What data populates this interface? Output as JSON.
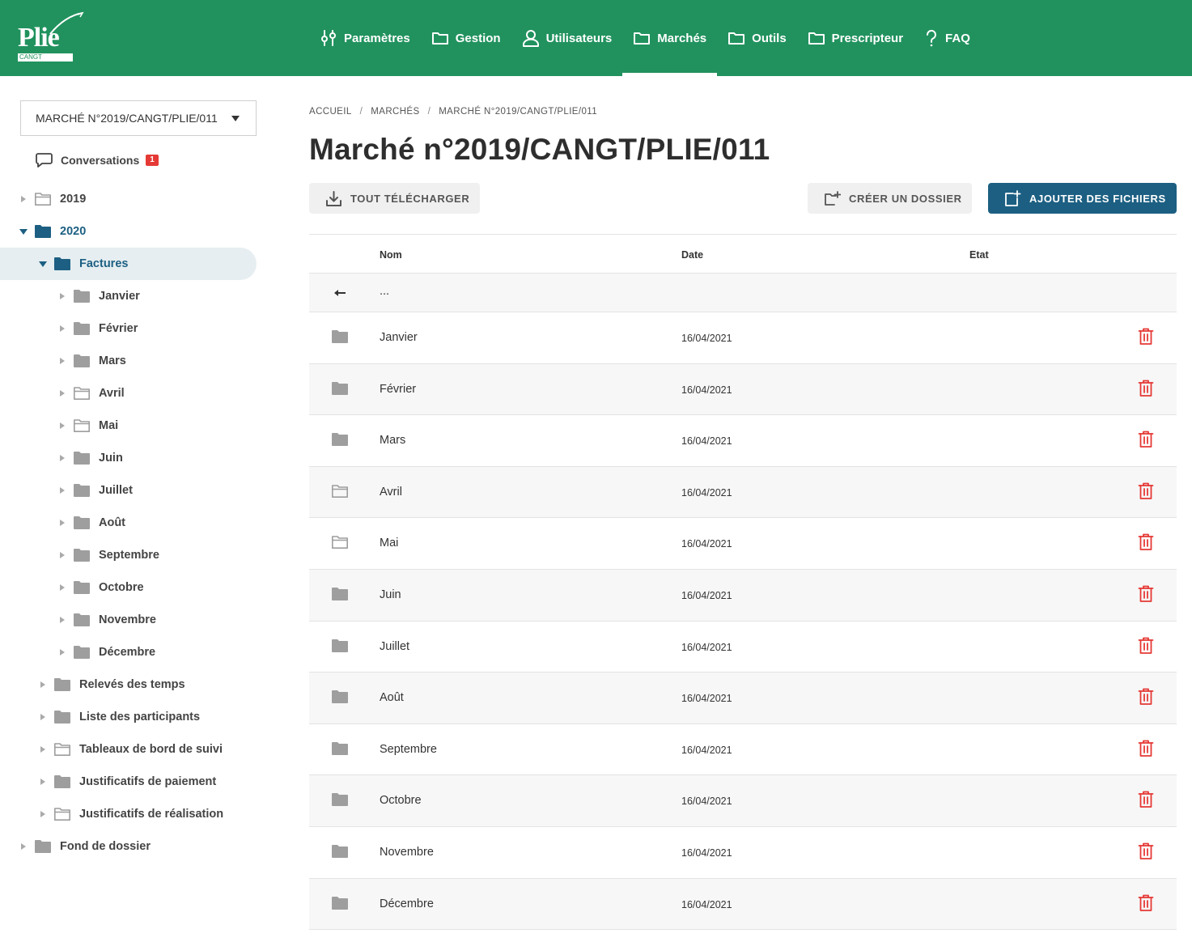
{
  "header": {
    "logo_text": "Plie",
    "logo_tag": "CANGT",
    "nav": [
      {
        "label": "Paramètres",
        "icon": "sliders-icon"
      },
      {
        "label": "Gestion",
        "icon": "folder-icon"
      },
      {
        "label": "Utilisateurs",
        "icon": "user-icon"
      },
      {
        "label": "Marchés",
        "icon": "folder-icon",
        "active": true
      },
      {
        "label": "Outils",
        "icon": "folder-icon"
      },
      {
        "label": "Prescripteur",
        "icon": "folder-icon"
      },
      {
        "label": "FAQ",
        "icon": "question-icon"
      }
    ]
  },
  "sidebar": {
    "market_select": "MARCHÉ N°2019/CANGT/PLIE/011",
    "conversations_label": "Conversations",
    "conversations_count": "1",
    "tree": [
      {
        "label": "2019",
        "level": 0,
        "expanded": false,
        "filled": false
      },
      {
        "label": "2020",
        "level": 0,
        "expanded": true,
        "filled": true
      },
      {
        "label": "Factures",
        "level": 1,
        "expanded": true,
        "filled": true,
        "selected": true
      },
      {
        "label": "Janvier",
        "level": 2,
        "filled": true
      },
      {
        "label": "Février",
        "level": 2,
        "filled": true
      },
      {
        "label": "Mars",
        "level": 2,
        "filled": true
      },
      {
        "label": "Avril",
        "level": 2,
        "filled": false
      },
      {
        "label": "Mai",
        "level": 2,
        "filled": false
      },
      {
        "label": "Juin",
        "level": 2,
        "filled": true
      },
      {
        "label": "Juillet",
        "level": 2,
        "filled": true
      },
      {
        "label": "Août",
        "level": 2,
        "filled": true
      },
      {
        "label": "Septembre",
        "level": 2,
        "filled": true
      },
      {
        "label": "Octobre",
        "level": 2,
        "filled": true
      },
      {
        "label": "Novembre",
        "level": 2,
        "filled": true
      },
      {
        "label": "Décembre",
        "level": 2,
        "filled": true
      },
      {
        "label": "Relevés des temps",
        "level": 1,
        "filled": true
      },
      {
        "label": "Liste des participants",
        "level": 1,
        "filled": true
      },
      {
        "label": "Tableaux de bord de suivi",
        "level": 1,
        "filled": false
      },
      {
        "label": "Justificatifs de paiement",
        "level": 1,
        "filled": true
      },
      {
        "label": "Justificatifs de réalisation",
        "level": 1,
        "filled": false
      },
      {
        "label": "Fond de dossier",
        "level": 0,
        "filled": true
      }
    ]
  },
  "main": {
    "breadcrumb": [
      "ACCUEIL",
      "MARCHÉS",
      "MARCHÉ N°2019/CANGT/PLIE/011"
    ],
    "breadcrumb_sep": "/",
    "title": "Marché n°2019/CANGT/PLIE/011",
    "buttons": {
      "download_all": "TOUT TÉLÉCHARGER",
      "create_folder": "CRÉER UN DOSSIER",
      "add_files": "AJOUTER DES FICHIERS"
    },
    "table": {
      "headers": {
        "name": "Nom",
        "date": "Date",
        "state": "Etat"
      },
      "parent_label": "...",
      "rows": [
        {
          "name": "Janvier",
          "date": "16/04/2021",
          "filled": true
        },
        {
          "name": "Février",
          "date": "16/04/2021",
          "filled": true
        },
        {
          "name": "Mars",
          "date": "16/04/2021",
          "filled": true
        },
        {
          "name": "Avril",
          "date": "16/04/2021",
          "filled": false
        },
        {
          "name": "Mai",
          "date": "16/04/2021",
          "filled": false
        },
        {
          "name": "Juin",
          "date": "16/04/2021",
          "filled": true
        },
        {
          "name": "Juillet",
          "date": "16/04/2021",
          "filled": true
        },
        {
          "name": "Août",
          "date": "16/04/2021",
          "filled": true
        },
        {
          "name": "Septembre",
          "date": "16/04/2021",
          "filled": true
        },
        {
          "name": "Octobre",
          "date": "16/04/2021",
          "filled": true
        },
        {
          "name": "Novembre",
          "date": "16/04/2021",
          "filled": true
        },
        {
          "name": "Décembre",
          "date": "16/04/2021",
          "filled": true
        }
      ]
    }
  },
  "colors": {
    "brand_green": "#21925e",
    "accent_blue": "#1c5f82",
    "danger_red": "#e53935",
    "folder_grey": "#9e9e9e"
  }
}
